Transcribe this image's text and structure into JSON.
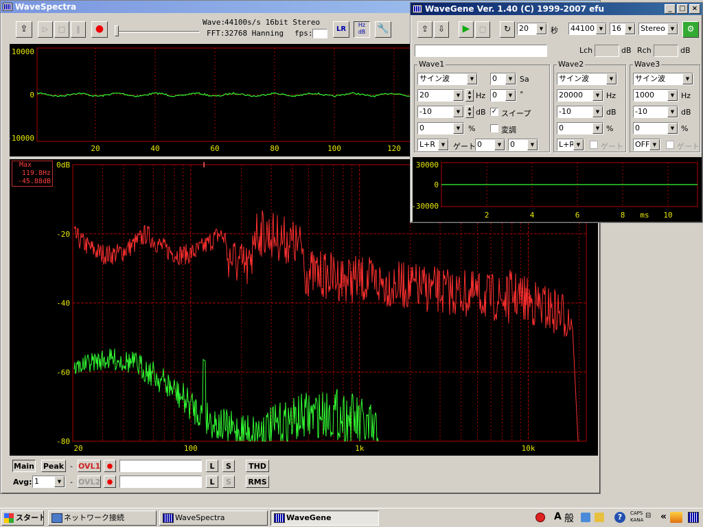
{
  "spectra": {
    "title": "WaveSpectra",
    "wave_info": "44100s/s 16bit Stereo",
    "wave_label": "Wave:",
    "fft_label": "FFT:",
    "fft_info": "32768 Hanning",
    "fps_label": "fps:",
    "lr_label": "LR",
    "hz_db_label": "Hz dB",
    "wave_plot": {
      "y_ticks": [
        "10000",
        "0",
        "-10000"
      ],
      "x_ticks": [
        "20",
        "40",
        "60",
        "80",
        "100",
        "120"
      ]
    },
    "spectrum": {
      "max_label": "Max",
      "max_freq": "119.8Hz",
      "max_db": "-45.88dB",
      "y_ticks": [
        "0dB",
        "-20",
        "-40",
        "-60",
        "-80"
      ],
      "x_ticks": [
        "20",
        "100",
        "1k",
        "10k"
      ]
    },
    "bottom": {
      "main": "Main",
      "peak": "Peak",
      "dash1": "-",
      "dash2": "-",
      "ovl1": "OVL1",
      "ovl2": "OVL2",
      "avg_label": "Avg:",
      "avg_value": "1",
      "l": "L",
      "s": "S",
      "thd": "THD",
      "rms": "RMS"
    }
  },
  "gene": {
    "title": "WaveGene  Ver. 1.40  (C) 1999-2007 efu",
    "duration": "20",
    "sec_label": "秒",
    "rate": "44100",
    "bits": "16",
    "channels": "Stereo",
    "lch_label": "Lch",
    "rch_label": "Rch",
    "db": "dB",
    "wave1": {
      "title": "Wave1",
      "type": "サイン波",
      "sa_value": "0",
      "sa_unit": "Sa",
      "freq": "20",
      "hz": "Hz",
      "phase": "0",
      "deg": "°",
      "level": "-10",
      "db": "dB",
      "sweep_label": "スイープ",
      "pct_value": "0",
      "pct": "%",
      "mod_label": "変調",
      "route": "L+R",
      "gate_label": "ゲート:",
      "gate1": "0",
      "gate2": "0"
    },
    "wave2": {
      "title": "Wave2",
      "type": "サイン波",
      "freq": "20000",
      "hz": "Hz",
      "level": "-10",
      "db": "dB",
      "pct_value": "0",
      "pct": "%",
      "route": "L+R",
      "gate_label": "ゲート"
    },
    "wave3": {
      "title": "Wave3",
      "type": "サイン波",
      "freq": "1000",
      "hz": "Hz",
      "level": "-10",
      "db": "dB",
      "pct_value": "0",
      "pct": "%",
      "route": "OFF",
      "gate_label": "ゲート"
    },
    "scope": {
      "y_ticks": [
        "30000",
        "0",
        "-30000"
      ],
      "x_ticks": [
        "2",
        "4",
        "6",
        "8",
        "10"
      ],
      "unit": "ms"
    }
  },
  "taskbar": {
    "start": "スタート",
    "items": [
      "ネットワーク接続",
      "WaveSpectra",
      "WaveGene"
    ],
    "tray": {
      "ime_a": "A",
      "ime_mode": "般",
      "caps": "CAPS",
      "kana": "KANA",
      "chevron": "«"
    }
  },
  "colors": {
    "red_trace": "#ff3030",
    "green_trace": "#33ff33",
    "grid": "#b00000",
    "tick": "#e8e800"
  }
}
